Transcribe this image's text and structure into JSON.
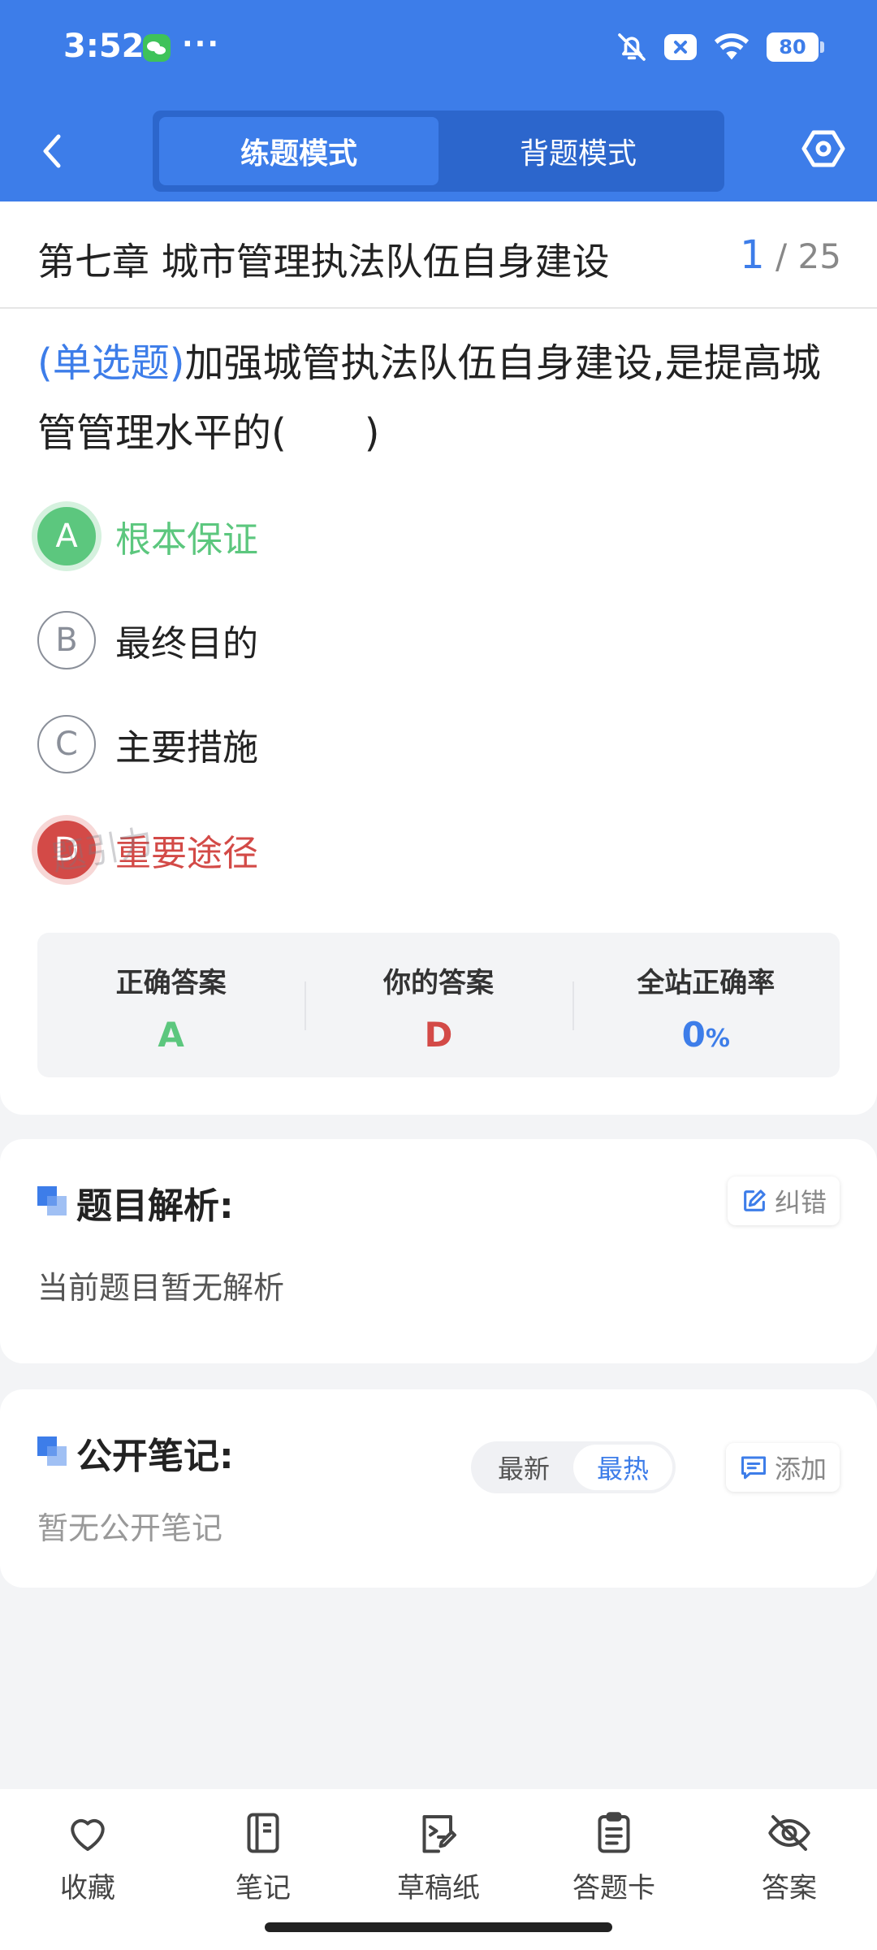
{
  "status_bar": {
    "time": "3:52",
    "dots": "···",
    "battery": "80"
  },
  "header": {
    "tabs": [
      {
        "label": "练题模式",
        "active": true
      },
      {
        "label": "背题模式",
        "active": false
      }
    ],
    "accent_color": "#3d7de9"
  },
  "chapter": {
    "title": "第七章 城市管理执法队伍自身建设",
    "current": "1",
    "total_sep": "/ 25"
  },
  "question": {
    "type": "(单选题)",
    "text": "加强城管执法队伍自身建设,是提高城管管理水平的(　　)"
  },
  "options": [
    {
      "letter": "A",
      "text": "根本保证",
      "state": "correct"
    },
    {
      "letter": "B",
      "text": "最终目的",
      "state": "normal"
    },
    {
      "letter": "C",
      "text": "主要措施",
      "state": "normal"
    },
    {
      "letter": "D",
      "text": "重要途径",
      "state": "wrong"
    }
  ],
  "stats": {
    "correct_label": "正确答案",
    "correct_value": "A",
    "yours_label": "你的答案",
    "yours_value": "D",
    "rate_label": "全站正确率",
    "rate_value": "0",
    "rate_unit": "%",
    "watermark": "题引力"
  },
  "analysis": {
    "title": "题目解析:",
    "report_label": "纠错",
    "text": "当前题目暂无解析"
  },
  "notes": {
    "title": "公开笔记:",
    "sort_options": [
      "最新",
      "最热"
    ],
    "active_sort": "最热",
    "add_label": "添加",
    "empty_text": "暂无公开笔记"
  },
  "bottom_bar": {
    "items": [
      {
        "label": "收藏",
        "icon": "heart-icon"
      },
      {
        "label": "笔记",
        "icon": "notebook-icon"
      },
      {
        "label": "草稿纸",
        "icon": "draft-paper-icon"
      },
      {
        "label": "答题卡",
        "icon": "answer-sheet-icon"
      },
      {
        "label": "答案",
        "icon": "eye-off-icon"
      }
    ]
  },
  "colors": {
    "correct": "#5cc77e",
    "wrong": "#d34a47"
  }
}
